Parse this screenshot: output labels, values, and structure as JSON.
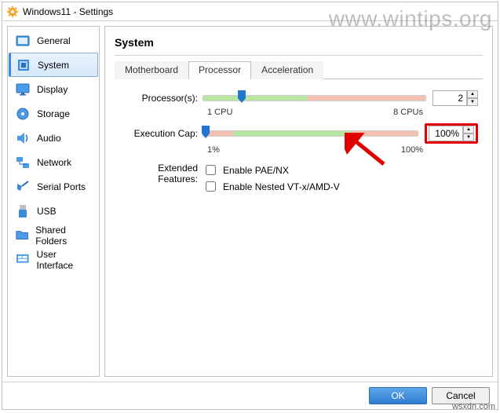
{
  "window": {
    "title": "Windows11 - Settings"
  },
  "watermark": "www.wintips.org",
  "watermark2": "wsxdn.com",
  "sidebar": {
    "items": [
      {
        "label": "General"
      },
      {
        "label": "System"
      },
      {
        "label": "Display"
      },
      {
        "label": "Storage"
      },
      {
        "label": "Audio"
      },
      {
        "label": "Network"
      },
      {
        "label": "Serial Ports"
      },
      {
        "label": "USB"
      },
      {
        "label": "Shared Folders"
      },
      {
        "label": "User Interface"
      }
    ],
    "selected": "System"
  },
  "main": {
    "heading": "System",
    "tabs": [
      {
        "label": "Motherboard"
      },
      {
        "label": "Processor"
      },
      {
        "label": "Acceleration"
      }
    ],
    "active_tab": "Processor",
    "processors": {
      "label": "Processor(s):",
      "value": "2",
      "min_label": "1 CPU",
      "max_label": "8 CPUs",
      "slider_percent": 16,
      "green_start": 0,
      "green_end": 47,
      "red_start": 47,
      "red_end": 100
    },
    "execution_cap": {
      "label": "Execution Cap:",
      "value": "100%",
      "min_label": "1%",
      "max_label": "100%",
      "slider_percent": 0,
      "red1_start": 0,
      "red1_end": 14,
      "green_start": 14,
      "green_end": 69,
      "red2_start": 69,
      "red2_end": 100
    },
    "extended": {
      "label": "Extended Features:",
      "opt1": "Enable PAE/NX",
      "opt2": "Enable Nested VT-x/AMD-V"
    }
  },
  "footer": {
    "ok": "OK",
    "cancel": "Cancel"
  }
}
